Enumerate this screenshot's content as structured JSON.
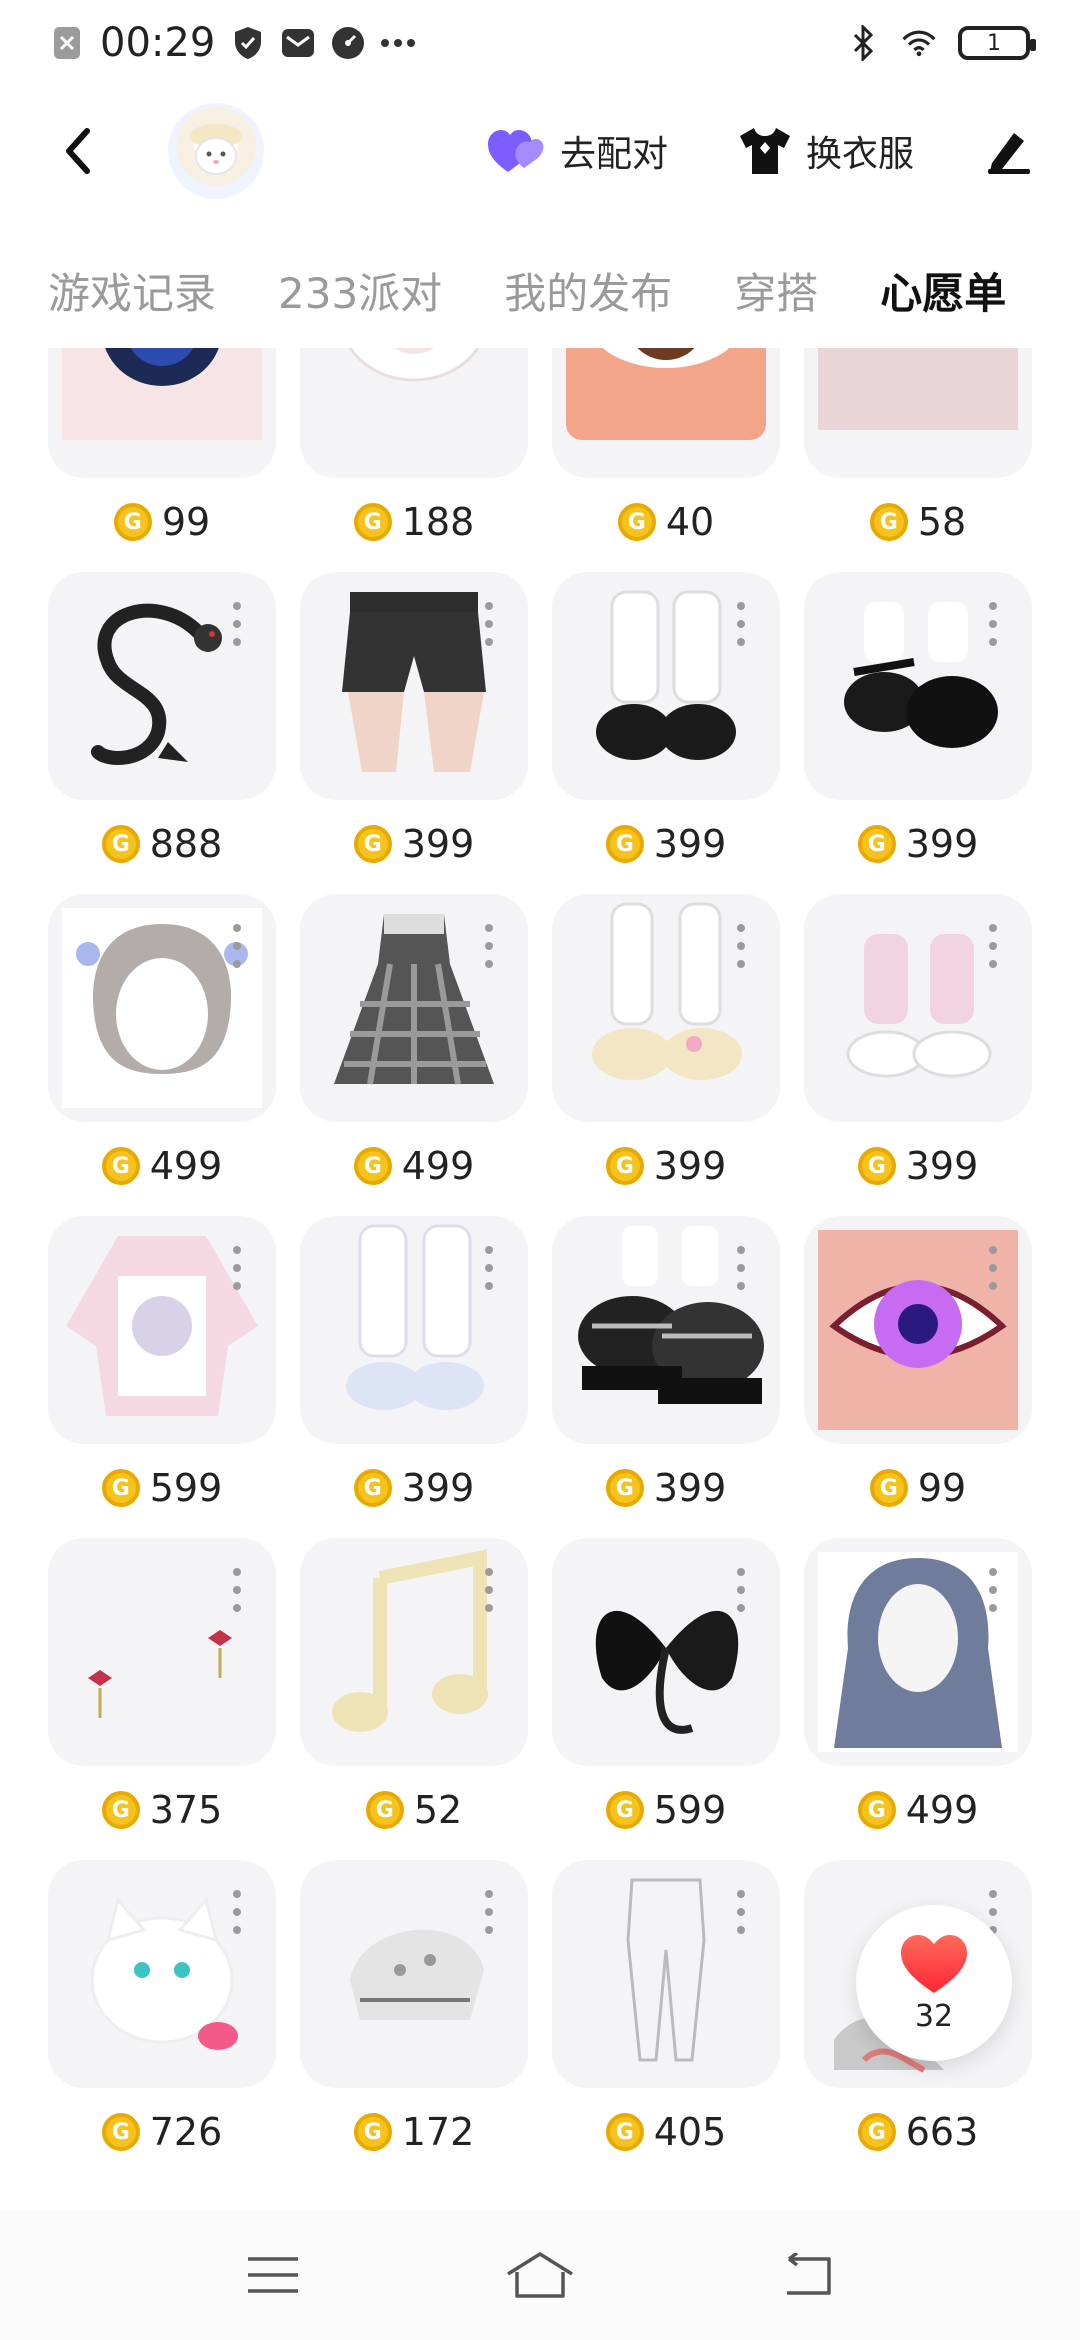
{
  "status_bar": {
    "time": "00:29",
    "battery": "1"
  },
  "topnav": {
    "match_label": "去配对",
    "dress_label": "换衣服"
  },
  "tabs": [
    {
      "label": "游戏记录",
      "active": false
    },
    {
      "label": "233派对",
      "active": false
    },
    {
      "label": "我的发布",
      "active": false
    },
    {
      "label": "穿搭",
      "active": false
    },
    {
      "label": "心愿单",
      "active": true
    }
  ],
  "items": [
    {
      "name": "eye-starry",
      "price": "99"
    },
    {
      "name": "white-pacifier",
      "price": "188"
    },
    {
      "name": "brown-eye",
      "price": "40"
    },
    {
      "name": "eyebrow",
      "price": "58"
    },
    {
      "name": "black-dragon",
      "price": "888"
    },
    {
      "name": "denim-shorts",
      "price": "399"
    },
    {
      "name": "white-socks-black-shoes",
      "price": "399"
    },
    {
      "name": "black-mary-janes",
      "price": "399"
    },
    {
      "name": "twin-tail-hair",
      "price": "499"
    },
    {
      "name": "plaid-dress",
      "price": "499"
    },
    {
      "name": "cream-sneakers-legwarmers",
      "price": "399"
    },
    {
      "name": "pink-legwarmers-shoes",
      "price": "399"
    },
    {
      "name": "pink-sweater",
      "price": "599"
    },
    {
      "name": "blue-legwarmers",
      "price": "399"
    },
    {
      "name": "plaid-platform-shoes",
      "price": "399"
    },
    {
      "name": "purple-eye",
      "price": "99"
    },
    {
      "name": "bow-earrings",
      "price": "375"
    },
    {
      "name": "music-note",
      "price": "52"
    },
    {
      "name": "black-lily",
      "price": "599"
    },
    {
      "name": "blue-long-hair",
      "price": "499"
    },
    {
      "name": "white-cat-plush",
      "price": "726"
    },
    {
      "name": "lace-headscarf",
      "price": "172"
    },
    {
      "name": "white-leggings",
      "price": "405"
    },
    {
      "name": "grey-hair-partial",
      "price": "663"
    }
  ],
  "favorite_count": "32",
  "colors": {
    "accent": "#ff7a1a",
    "coin": "#f6c21c",
    "heart": "#ff3b3b",
    "match_heart": "#7b5cff"
  }
}
